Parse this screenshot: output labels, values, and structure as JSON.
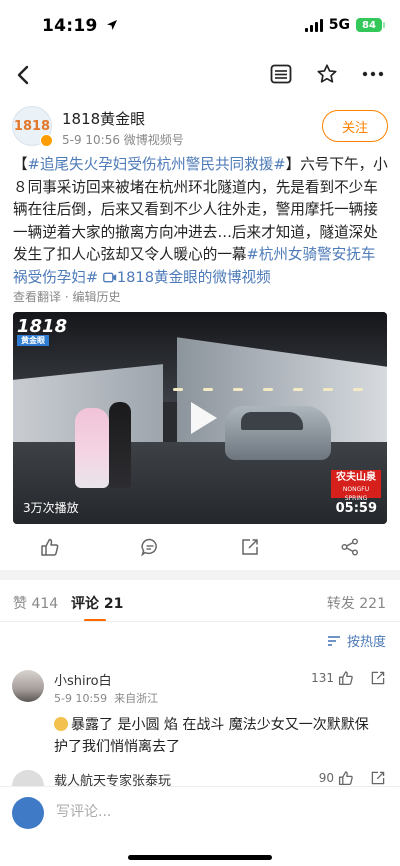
{
  "status_bar": {
    "time": "14:19",
    "network": "5G",
    "battery": "84"
  },
  "nav": {
    "back": "back-icon",
    "icons": [
      "menu-icon",
      "star-icon",
      "more-icon"
    ]
  },
  "author": {
    "name": "1818黄金眼",
    "meta": "5-9 10:56  微博视频号",
    "avatar_text": "1818",
    "follow_label": "关注"
  },
  "post": {
    "bracket_open": "【",
    "topic1": "#追尾失火孕妇受伤杭州警民共同救援#",
    "bracket_close": "】",
    "body": "六号下午，小８同事采访回来被堵在杭州环北隧道内，先是看到不少车辆在往后倒，后来又看到不少人往外走，警用摩托一辆接一辆逆着大家的撤离方向冲进去…后来才知道，隧道深处发生了扣人心弦却又令人暖心的一幕",
    "topic2": "#杭州女骑警安抚车祸受伤孕妇#",
    "video_link": "1818黄金眼的微博视频",
    "sub_actions": "查看翻译 · 编辑历史"
  },
  "video": {
    "logo_text": "1818",
    "logo_sub": "黄金眼",
    "plays": "3万次播放",
    "duration": "05:59",
    "sponsor": "农夫山泉",
    "sponsor_sub": "NONGFU SPRING"
  },
  "actions": [
    "like-icon",
    "comment-icon",
    "share-edit-icon",
    "share-icon"
  ],
  "tabs": {
    "likes_label": "赞",
    "likes_count": "414",
    "comments_label": "评论",
    "comments_count": "21",
    "reposts_label": "转发",
    "reposts_count": "221"
  },
  "sort_label": "按热度",
  "comments": [
    {
      "name": "小shiro白",
      "time": "5-9 10:59",
      "location": "来自浙江",
      "likes": "131",
      "text": "暴露了 是小圆 焰 在战斗 魔法少女又一次默默保护了我们悄悄离去了"
    },
    {
      "name": "载人航天专家张泰玩",
      "likes": "90"
    }
  ],
  "input_placeholder": "写评论..."
}
